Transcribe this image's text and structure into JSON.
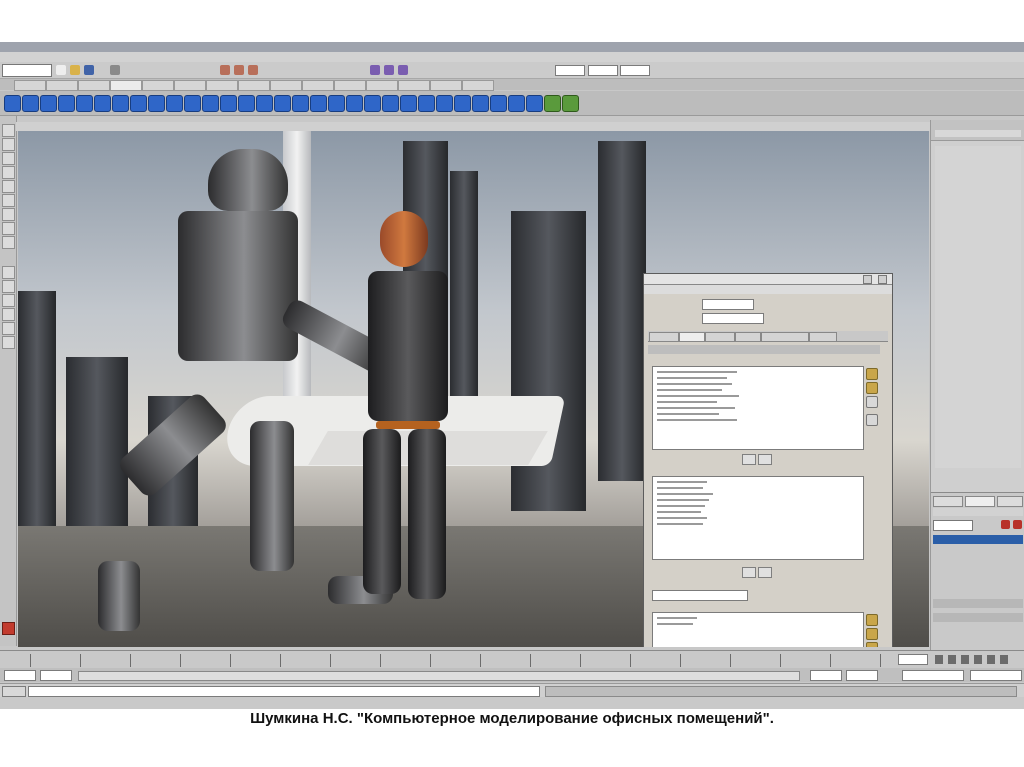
{
  "caption": "Шумкина Н.С. \"Компьютерное моделирование офисных помещений\".",
  "colors": {
    "shelf_icon": "#2f66c8",
    "selected_layer": "#2a5ea8",
    "viewport_sky": "#c2c7cd"
  },
  "icons": {
    "window_controls": [
      "minimize-icon",
      "maximize-icon",
      "close-icon"
    ],
    "playback": [
      "go-to-start-icon",
      "step-back-icon",
      "play-backward-icon",
      "play-forward-icon",
      "step-forward-icon",
      "go-to-end-icon"
    ]
  }
}
